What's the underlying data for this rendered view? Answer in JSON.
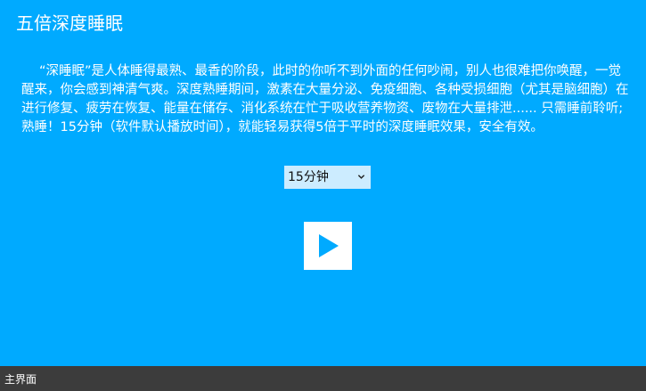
{
  "page": {
    "title": "五倍深度睡眠",
    "description": "“深睡眠”是人体睡得最熟、最香的阶段，此时的你听不到外面的任何吵闹，别人也很难把你唤醒，一觉醒来，你会感到神清气爽。深度熟睡期间，激素在大量分泌、免疫细胞、各种受损细胞（尤其是脑细胞）在进行修复、疲劳在恢复、能量在储存、消化系统在忙于吸收营养物资、废物在大量排泄...... 只需睡前聆听;熟睡！15分钟（软件默认播放时间），就能轻易获得5倍于平时的深度睡眠效果，安全有效。"
  },
  "duration_select": {
    "value": "15分钟",
    "icon": "chevron-down-icon"
  },
  "play_button": {
    "icon": "play-icon"
  },
  "bottom_bar": {
    "label": "主界面"
  },
  "colors": {
    "background": "#00aaff",
    "select_background": "#ccecff",
    "play_icon": "#00aaff",
    "bottom_bar": "#3c3c3c"
  }
}
